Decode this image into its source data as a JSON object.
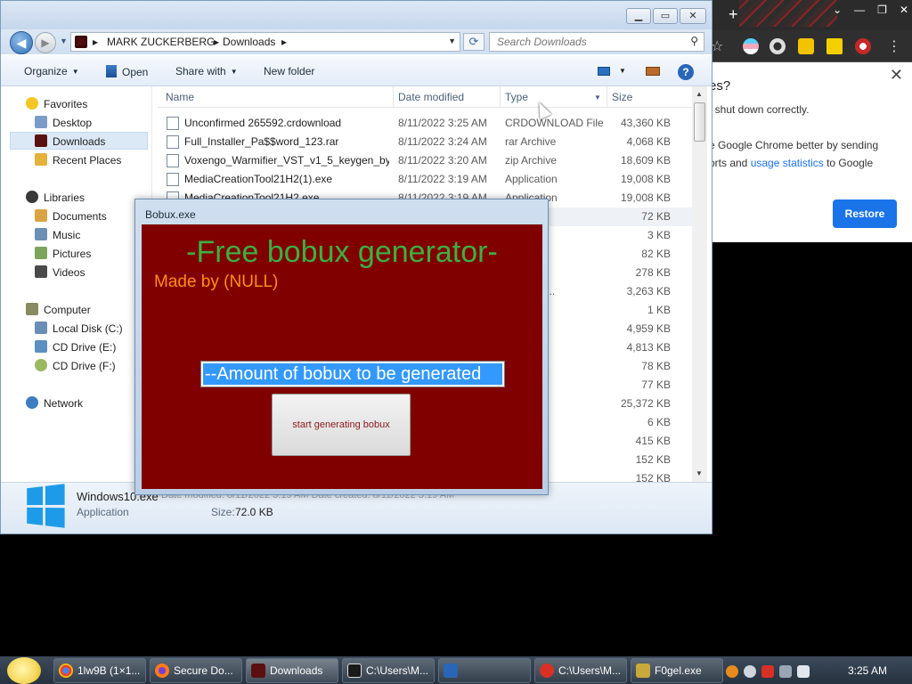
{
  "chrome": {
    "new_tab_symbol": "+",
    "bubble": {
      "title_fragment": "es?",
      "line1": "t shut down correctly.",
      "line2": "e Google Chrome better by sending",
      "line3_a": "orts and",
      "line3_link": "usage statistics",
      "line3_b": "to Google",
      "restore_label": "Restore",
      "close_symbol": "✕"
    }
  },
  "explorer": {
    "breadcrumb": [
      "MARK ZUCKERBERG",
      "Downloads"
    ],
    "search_placeholder": "Search Downloads",
    "toolbar": {
      "organize": "Organize",
      "open": "Open",
      "share_with": "Share with",
      "new_folder": "New folder",
      "help": "?"
    },
    "nav": {
      "favorites": "Favorites",
      "desktop": "Desktop",
      "downloads": "Downloads",
      "recent_places": "Recent Places",
      "libraries": "Libraries",
      "documents": "Documents",
      "music": "Music",
      "pictures": "Pictures",
      "videos": "Videos",
      "computer": "Computer",
      "local_disk": "Local Disk (C:)",
      "cd_drive_e": "CD Drive (E:)",
      "cd_drive_f": "CD Drive (F:)",
      "network": "Network"
    },
    "columns": {
      "name": "Name",
      "date_modified": "Date modified",
      "type": "Type",
      "size": "Size"
    },
    "files": [
      {
        "name": "Unconfirmed 265592.crdownload",
        "date": "8/11/2022 3:25 AM",
        "type": "CRDOWNLOAD File",
        "size": "43,360 KB"
      },
      {
        "name": "Full_Installer_Pa$$word_123.rar",
        "date": "8/11/2022 3:24 AM",
        "type": "rar Archive",
        "size": "4,068 KB"
      },
      {
        "name": "Voxengo_Warmifier_VST_v1_5_keygen_by...",
        "date": "8/11/2022 3:20 AM",
        "type": "zip Archive",
        "size": "18,609 KB"
      },
      {
        "name": "MediaCreationTool21H2(1).exe",
        "date": "8/11/2022 3:19 AM",
        "type": "Application",
        "size": "19,008 KB"
      },
      {
        "name": "MediaCreationTool21H2.exe",
        "date": "8/11/2022 3:19 AM",
        "type": "Application",
        "size": "19,008 KB"
      },
      {
        "name": "",
        "date": "",
        "type": "on",
        "size": "72 KB"
      },
      {
        "name": "",
        "date": "",
        "type": "",
        "size": "3 KB"
      },
      {
        "name": "",
        "date": "",
        "type": "Movie",
        "size": "82 KB"
      },
      {
        "name": "",
        "date": "",
        "type": "",
        "size": "278 KB"
      },
      {
        "name": "",
        "date": "",
        "type": "io File (V...",
        "size": "3,263 KB"
      },
      {
        "name": "",
        "date": "",
        "type": "STS File",
        "size": "1 KB"
      },
      {
        "name": "",
        "date": "",
        "type": "on",
        "size": "4,959 KB"
      },
      {
        "name": "",
        "date": "",
        "type": "on",
        "size": "4,813 KB"
      },
      {
        "name": "",
        "date": "",
        "type": "o Project",
        "size": "78 KB"
      },
      {
        "name": "",
        "date": "",
        "type": "",
        "size": "77 KB"
      },
      {
        "name": "",
        "date": "",
        "type": "Movie",
        "size": "25,372 KB"
      },
      {
        "name": "",
        "date": "",
        "type": "",
        "size": "6 KB"
      },
      {
        "name": "",
        "date": "",
        "type": "Movie",
        "size": "415 KB"
      },
      {
        "name": "",
        "date": "",
        "type": "",
        "size": "152 KB"
      },
      {
        "name": "",
        "date": "",
        "type": "",
        "size": "152 KB"
      }
    ],
    "details": {
      "name": "Windows10.exe",
      "type": "Application",
      "size_label": "Size:",
      "size": "72.0 KB",
      "ghost_text": "Date modified: 8/11/2022 3:19 AM        Date created: 8/11/2022 3:19 AM"
    }
  },
  "bobux": {
    "window_title": "Bobux.exe",
    "heading": "-Free bobux generator-",
    "credit": "Made by (NULL)",
    "amount_value": "--Amount of bobux to be generated",
    "start_label": "start generating bobux"
  },
  "taskbar": {
    "items": [
      {
        "label": "1lw9B (1×1..."
      },
      {
        "label": "Secure Do..."
      },
      {
        "label": "Downloads"
      },
      {
        "label": "C:\\Users\\M..."
      },
      {
        "label": ""
      },
      {
        "label": "C:\\Users\\M..."
      },
      {
        "label": "F0gel.exe"
      }
    ],
    "clock": "3:25 AM"
  }
}
